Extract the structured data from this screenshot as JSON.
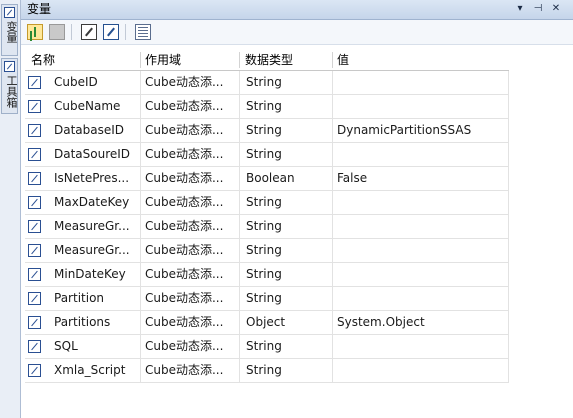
{
  "side_tabs": [
    {
      "label": "变量",
      "icon": "variable-icon"
    },
    {
      "label": "工具箱",
      "icon": "toolbox-icon"
    }
  ],
  "panel": {
    "title": "变量",
    "buttons": {
      "dropdown": "▾",
      "pin": "⊣",
      "close": "✕"
    }
  },
  "toolbar": {
    "items": [
      "add-variable-icon",
      "delete-variable-icon",
      "show-system-variables-icon",
      "show-all-variables-icon",
      "choose-columns-icon"
    ]
  },
  "grid": {
    "columns": [
      "名称",
      "作用域",
      "数据类型",
      "值"
    ],
    "rows": [
      {
        "name": "CubeID",
        "scope": "Cube动态添...",
        "type": "String",
        "value": ""
      },
      {
        "name": "CubeName",
        "scope": "Cube动态添...",
        "type": "String",
        "value": ""
      },
      {
        "name": "DatabaseID",
        "scope": "Cube动态添...",
        "type": "String",
        "value": "DynamicPartitionSSAS"
      },
      {
        "name": "DataSoureID",
        "scope": "Cube动态添...",
        "type": "String",
        "value": ""
      },
      {
        "name": "IsNetePres...",
        "scope": "Cube动态添...",
        "type": "Boolean",
        "value": "False"
      },
      {
        "name": "MaxDateKey",
        "scope": "Cube动态添...",
        "type": "String",
        "value": ""
      },
      {
        "name": "MeasureGr...",
        "scope": "Cube动态添...",
        "type": "String",
        "value": ""
      },
      {
        "name": "MeasureGr...",
        "scope": "Cube动态添...",
        "type": "String",
        "value": ""
      },
      {
        "name": "MinDateKey",
        "scope": "Cube动态添...",
        "type": "String",
        "value": ""
      },
      {
        "name": "Partition",
        "scope": "Cube动态添...",
        "type": "String",
        "value": ""
      },
      {
        "name": "Partitions",
        "scope": "Cube动态添...",
        "type": "Object",
        "value": "System.Object"
      },
      {
        "name": "SQL",
        "scope": "Cube动态添...",
        "type": "String",
        "value": ""
      },
      {
        "name": "Xmla_Script",
        "scope": "Cube动态添...",
        "type": "String",
        "value": ""
      }
    ]
  }
}
